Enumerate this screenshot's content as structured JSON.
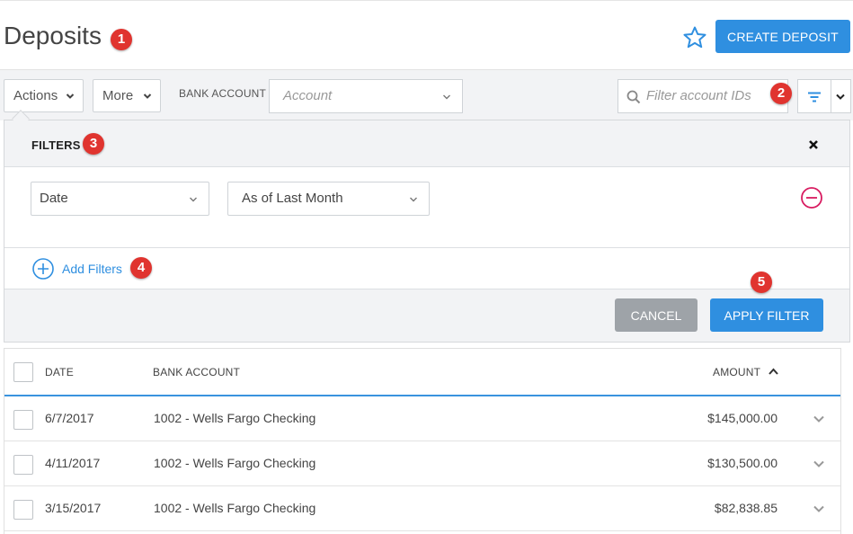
{
  "page": {
    "title": "Deposits",
    "create_label": "CREATE DEPOSIT"
  },
  "toolbar": {
    "actions_label": "Actions",
    "more_label": "More",
    "bank_account_label": "BANK ACCOUNT",
    "account_placeholder": "Account",
    "search_placeholder": "Filter account IDs"
  },
  "filters": {
    "title": "FILTERS",
    "field_value": "Date",
    "condition_value": "As of Last Month",
    "add_label": "Add Filters",
    "cancel_label": "CANCEL",
    "apply_label": "APPLY FILTER"
  },
  "badges": [
    "1",
    "2",
    "3",
    "4",
    "5"
  ],
  "table": {
    "headers": {
      "date": "DATE",
      "bank_account": "BANK ACCOUNT",
      "amount": "AMOUNT"
    },
    "rows": [
      {
        "date": "6/7/2017",
        "bank_account": "1002 - Wells Fargo Checking",
        "amount": "$145,000.00"
      },
      {
        "date": "4/11/2017",
        "bank_account": "1002 - Wells Fargo Checking",
        "amount": "$130,500.00"
      },
      {
        "date": "3/15/2017",
        "bank_account": "1002 - Wells Fargo Checking",
        "amount": "$82,838.85"
      }
    ]
  },
  "colors": {
    "accent": "#2f8fe0",
    "badge": "#e0342f",
    "remove": "#d81b60",
    "cancel": "#9ea3a8"
  },
  "icons": [
    "star-icon",
    "chevron-down-icon",
    "search-icon",
    "filter-icon",
    "close-icon",
    "minus-circle-icon",
    "plus-circle-icon",
    "sort-up-icon"
  ]
}
